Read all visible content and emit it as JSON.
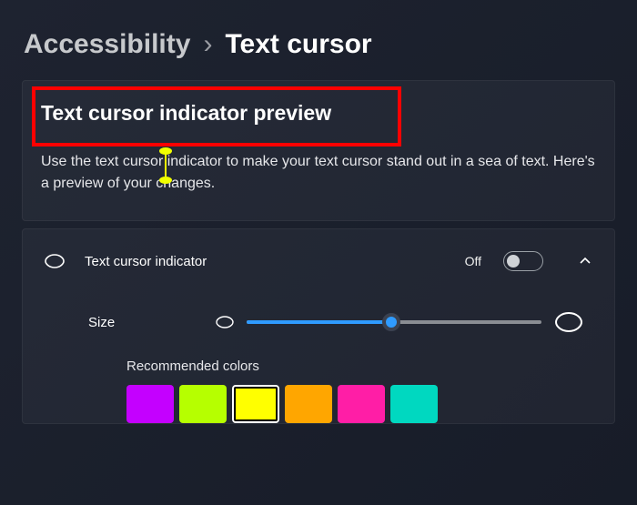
{
  "breadcrumb": {
    "parent": "Accessibility",
    "current": "Text cursor"
  },
  "preview": {
    "title": "Text cursor indicator preview",
    "desc": "Use the text cursor indicator to make your text cursor stand out in a sea of text. Here's a preview of your changes."
  },
  "indicator": {
    "label": "Text cursor indicator",
    "state_label": "Off",
    "on": false
  },
  "size": {
    "label": "Size",
    "value_percent": 49
  },
  "colors": {
    "label": "Recommended colors",
    "items": [
      {
        "hex": "#c400ff",
        "selected": false
      },
      {
        "hex": "#b6ff00",
        "selected": false
      },
      {
        "hex": "#ffff00",
        "selected": true
      },
      {
        "hex": "#ffa600",
        "selected": false
      },
      {
        "hex": "#ff1ea6",
        "selected": false
      },
      {
        "hex": "#00d8c0",
        "selected": false
      }
    ]
  }
}
